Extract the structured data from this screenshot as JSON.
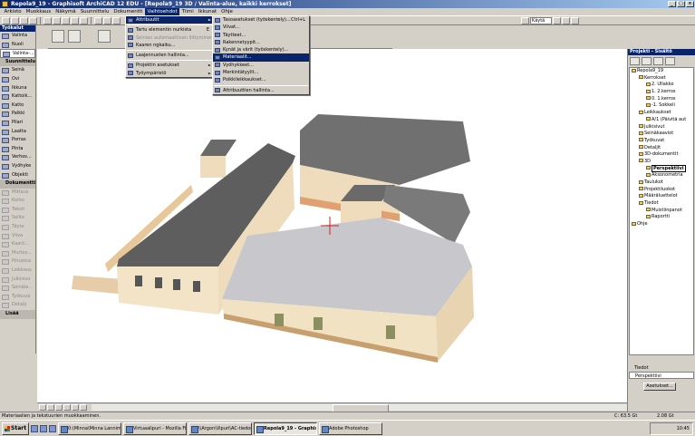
{
  "window": {
    "title": "Repola9_19 - Graphisoft ArchiCAD 12 EDU - [Repola9_19 3D / Valinta-alue, kaikki kerrokset]"
  },
  "menubar": [
    "Arkisto",
    "Muokkaus",
    "Näkymä",
    "Suunnittelu",
    "Dokumentti",
    "Vaihtoehdot",
    "Tiimi",
    "Ikkunat",
    "Ohje"
  ],
  "toolbar": {
    "layer_combo": "Käytä"
  },
  "toolbox": {
    "title": "Työkalut",
    "rows": [
      {
        "label": "Valinta",
        "kind": "tool"
      },
      {
        "label": "Nuoli",
        "kind": "tool"
      },
      {
        "label": "Valinta-...",
        "kind": "highlight"
      },
      {
        "label": "Suunnittelu",
        "kind": "section"
      },
      {
        "label": "Seinä",
        "kind": "tool"
      },
      {
        "label": "Ovi",
        "kind": "tool"
      },
      {
        "label": "Ikkuna",
        "kind": "tool"
      },
      {
        "label": "Kattoik...",
        "kind": "tool"
      },
      {
        "label": "Katto",
        "kind": "tool"
      },
      {
        "label": "Palkki",
        "kind": "tool"
      },
      {
        "label": "Pilari",
        "kind": "tool"
      },
      {
        "label": "Laatta",
        "kind": "tool"
      },
      {
        "label": "Porras",
        "kind": "tool"
      },
      {
        "label": "Pinta",
        "kind": "tool"
      },
      {
        "label": "Verhos...",
        "kind": "tool"
      },
      {
        "label": "Vyöhyke",
        "kind": "tool"
      },
      {
        "label": "Objekti",
        "kind": "tool"
      },
      {
        "label": "Dokumentti",
        "kind": "section"
      },
      {
        "label": "Mittaus",
        "kind": "disabled"
      },
      {
        "label": "Korko",
        "kind": "disabled"
      },
      {
        "label": "Teksti",
        "kind": "disabled"
      },
      {
        "label": "Selite",
        "kind": "disabled"
      },
      {
        "label": "Täyte",
        "kind": "disabled"
      },
      {
        "label": "Viiva",
        "kind": "disabled"
      },
      {
        "label": "Kaari/...",
        "kind": "disabled"
      },
      {
        "label": "Murtov...",
        "kind": "disabled"
      },
      {
        "label": "Piirustus",
        "kind": "disabled"
      },
      {
        "label": "Leikkaus",
        "kind": "disabled"
      },
      {
        "label": "Julkisivu",
        "kind": "disabled"
      },
      {
        "label": "Seinäle...",
        "kind": "disabled"
      },
      {
        "label": "Työkuva",
        "kind": "disabled"
      },
      {
        "label": "Detalji",
        "kind": "disabled"
      },
      {
        "label": "Lisää",
        "kind": "section"
      }
    ]
  },
  "menus": {
    "vaihtoehdot": {
      "items": [
        {
          "label": "Attribuutit",
          "arrow": "►",
          "state": "highlight",
          "shortcut": ""
        },
        {
          "label": "Tartu elementin nurkista",
          "arrow": "",
          "state": "normal",
          "shortcut": "E"
        },
        {
          "label": "Seinien automaattinen liittyminen",
          "arrow": "",
          "state": "disabled",
          "shortcut": ""
        },
        {
          "label": "Kaaren ngkaiku...",
          "arrow": "",
          "state": "normal",
          "shortcut": ""
        },
        {
          "label": "Laajennusten hallinta...",
          "arrow": "",
          "state": "normal",
          "shortcut": ""
        },
        {
          "label": "Projektin asetukset",
          "arrow": "►",
          "state": "normal",
          "shortcut": ""
        },
        {
          "label": "Työympäristö",
          "arrow": "►",
          "state": "normal",
          "shortcut": ""
        }
      ]
    },
    "attribuutit": {
      "items": [
        {
          "label": "Tasoasetukset (työskentely)...",
          "shortcut": "Ctrl+L",
          "state": "normal"
        },
        {
          "label": "Viivat...",
          "shortcut": "",
          "state": "normal"
        },
        {
          "label": "Täytteet...",
          "shortcut": "",
          "state": "normal"
        },
        {
          "label": "Rakennetyypit...",
          "shortcut": "",
          "state": "normal"
        },
        {
          "label": "Kynät ja värit (työskentely)...",
          "shortcut": "",
          "state": "normal"
        },
        {
          "label": "Materiaalit...",
          "shortcut": "",
          "state": "highlight"
        },
        {
          "label": "Vyöhykkeet...",
          "shortcut": "",
          "state": "normal"
        },
        {
          "label": "Merkintätyylit...",
          "shortcut": "",
          "state": "normal"
        },
        {
          "label": "Poikkileikkaukset...",
          "shortcut": "",
          "state": "normal"
        },
        {
          "label": "Attribuuttien hallinta...",
          "shortcut": "",
          "state": "normal"
        }
      ]
    }
  },
  "navigator": {
    "title": "Projekti - Sisältö",
    "tree": [
      {
        "label": "Repola9_19",
        "level": 0,
        "sel": false
      },
      {
        "label": "Kerrokset",
        "level": 1,
        "sel": false
      },
      {
        "label": "2. Ullakko",
        "level": 2,
        "sel": false
      },
      {
        "label": "1. 2.kerros",
        "level": 2,
        "sel": false
      },
      {
        "label": "0. 1.kerros",
        "level": 2,
        "sel": false
      },
      {
        "label": "-1. Sokkeli",
        "level": 2,
        "sel": false
      },
      {
        "label": "Leikkaukset",
        "level": 1,
        "sel": false
      },
      {
        "label": "A/1 (Päivitä aut",
        "level": 2,
        "sel": false
      },
      {
        "label": "Julkisivut",
        "level": 1,
        "sel": false
      },
      {
        "label": "Seinäkaaviot",
        "level": 1,
        "sel": false
      },
      {
        "label": "Työkuvat",
        "level": 1,
        "sel": false
      },
      {
        "label": "Detaljit",
        "level": 1,
        "sel": false
      },
      {
        "label": "3D-dokumentit",
        "level": 1,
        "sel": false
      },
      {
        "label": "3D",
        "level": 1,
        "sel": false
      },
      {
        "label": "Perspektiivi",
        "level": 2,
        "sel": true
      },
      {
        "label": "Aksonometria",
        "level": 2,
        "sel": false
      },
      {
        "label": "Taulukot",
        "level": 1,
        "sel": false
      },
      {
        "label": "Projektiluokot",
        "level": 1,
        "sel": false
      },
      {
        "label": "Määräluettelot",
        "level": 1,
        "sel": false
      },
      {
        "label": "Tiedot",
        "level": 1,
        "sel": false
      },
      {
        "label": "Muistiinpanot",
        "level": 2,
        "sel": false
      },
      {
        "label": "Raportti",
        "level": 2,
        "sel": false
      },
      {
        "label": "Ohje",
        "level": 0,
        "sel": false
      }
    ],
    "bottom": {
      "label": "Tiedot",
      "row": "Perspektiivi",
      "settings": "Asetukset..."
    }
  },
  "statusbar": {
    "message": "Materiaalien ja tekstuurien muokkaaminen.",
    "disk": "C: 63.5 Gt",
    "memory": "2.08 Gt"
  },
  "taskbar": {
    "start": "Start",
    "tasks": [
      {
        "label": "0:(Minna\\Minna Lannim...",
        "active": false
      },
      {
        "label": "Virtuaalipuri - Mozilla Fi...",
        "active": false
      },
      {
        "label": "\\\\Argon\\Vipuri\\AC-tiedos...",
        "active": false
      },
      {
        "label": "Repola9_19 - Graphis...",
        "active": true
      },
      {
        "label": "Adobe Photoshop",
        "active": false
      }
    ],
    "clock": "10:45"
  },
  "colors": {
    "titlebar": "#0a246a",
    "menu_highlight": "#0a246a",
    "wall": "#efdcbc",
    "roof": "#6e6e6e",
    "roof_light": "#c8c8cc"
  }
}
